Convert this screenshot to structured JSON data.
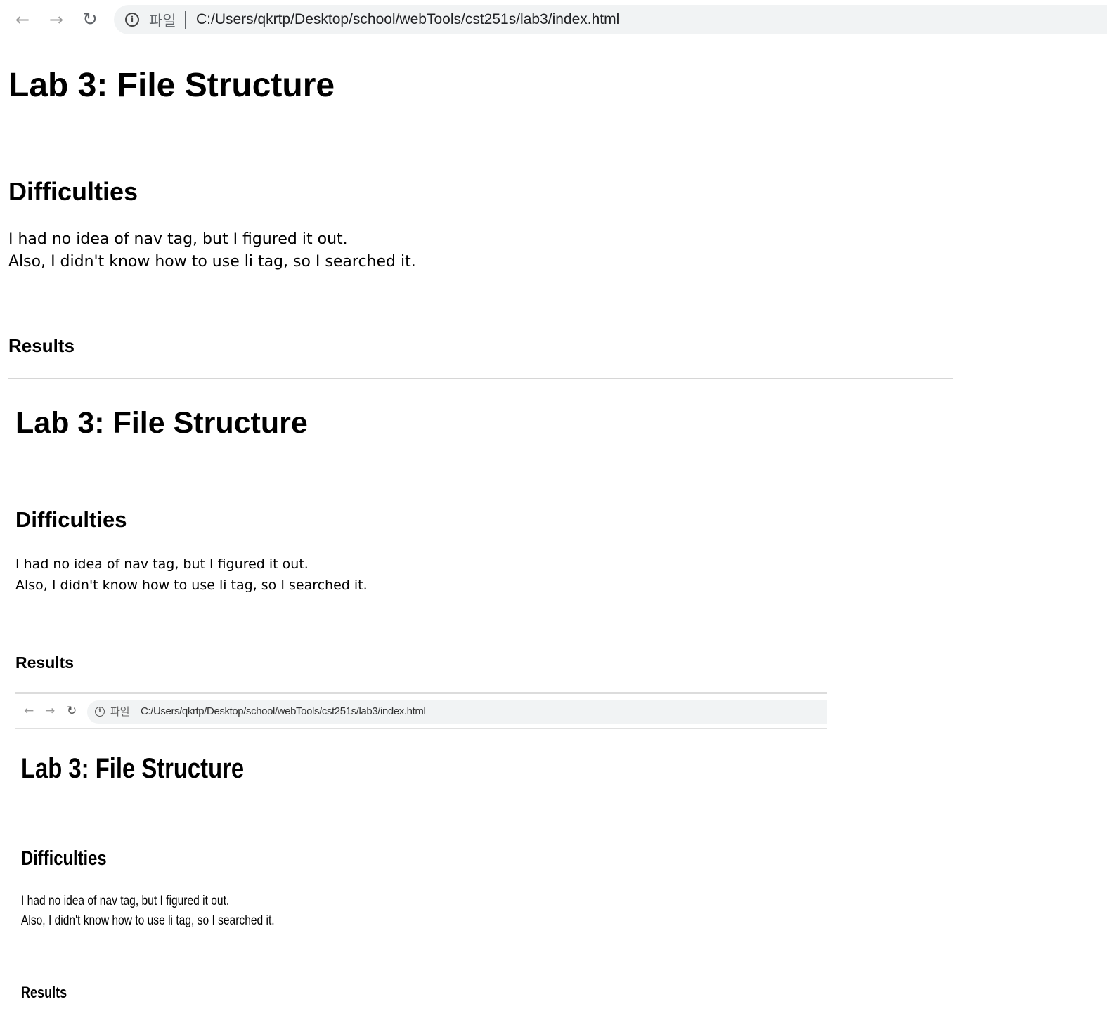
{
  "browser": {
    "back_glyph": "←",
    "forward_glyph": "→",
    "reload_glyph": "↻",
    "info_glyph": "i",
    "scheme_label": "파일",
    "url": "C:/Users/qkrtp/Desktop/school/webTools/cst251s/lab3/index.html"
  },
  "page": {
    "title": "Lab 3: File Structure",
    "difficulties_heading": "Difficulties",
    "para_line1": "I had no idea of nav tag, but I figured it out.",
    "para_line2": "Also, I didn't know how to use li tag, so I searched it.",
    "results_heading": "Results"
  },
  "nested": {
    "title": "Lab 3: File Structure",
    "difficulties_heading": "Difficulties",
    "para_line1": "I had no idea of nav tag, but I figured it out.",
    "para_line2": "Also, I didn't know how to use li tag, so I searched it.",
    "results_heading": "Results",
    "browser": {
      "back_glyph": "←",
      "forward_glyph": "→",
      "reload_glyph": "↻",
      "info_glyph": "i",
      "scheme_label": "파일",
      "url": "C:/Users/qkrtp/Desktop/school/webTools/cst251s/lab3/index.html"
    },
    "inner": {
      "title": "Lab 3: File Structure",
      "difficulties_heading": "Difficulties",
      "para_line1": "I had no idea of nav tag, but I figured it out.",
      "para_line2": "Also, I didn't know how to use li tag, so I searched it.",
      "results_heading": "Results"
    }
  }
}
